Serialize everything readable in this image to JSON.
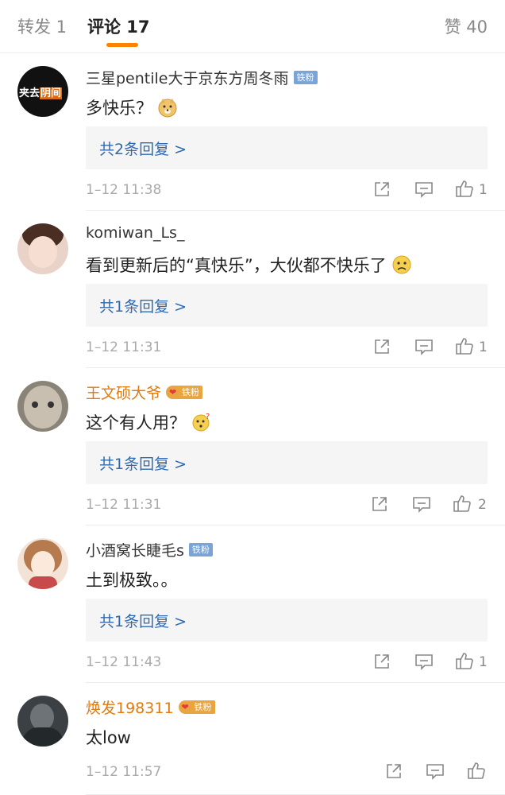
{
  "tabs": {
    "repost": "转发 1",
    "comments": "评论 17",
    "likes": "赞 40"
  },
  "accent_color": "#ff8200",
  "link_color": "#2e6ab2",
  "comments": [
    {
      "user": "三星pentile大于京东方周冬雨",
      "badge": "铁粉",
      "avatar_text": {
        "a": "夹去",
        "b": "阴间"
      },
      "text": "多快乐？",
      "emoji": "doge-emoji",
      "replies": "共2条回复 >",
      "time": "1–12 11:38",
      "likes": "1"
    },
    {
      "user": "komiwan_Ls_",
      "text": "看到更新后的“真快乐”，大伙都不快乐了",
      "emoji": "sad-face-emoji",
      "replies": "共1条回复 >",
      "time": "1–12 11:31",
      "likes": "1"
    },
    {
      "user": "王文硕大爷",
      "badge": "铁粉",
      "text": "这个有人用？",
      "emoji": "thinking-face-emoji",
      "replies": "共1条回复 >",
      "time": "1–12 11:31",
      "likes": "2"
    },
    {
      "user": "小酒窝长睫毛s",
      "badge": "铁粉",
      "text": "土到极致。。",
      "replies": "共1条回复 >",
      "time": "1–12 11:43",
      "likes": "1"
    },
    {
      "user": "焕发198311",
      "badge": "铁粉",
      "text": "太low",
      "time": "1–12 11:57"
    }
  ]
}
